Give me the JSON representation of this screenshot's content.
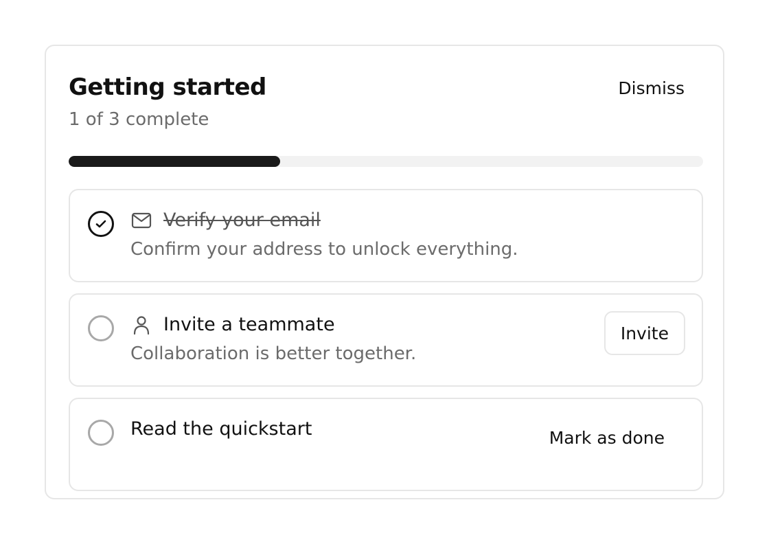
{
  "header": {
    "title": "Getting started",
    "progress_text": "1 of 3 complete",
    "dismiss_label": "Dismiss"
  },
  "progress": {
    "completed": 1,
    "total": 3,
    "fraction": 0.333,
    "fill_color": "#1a1a1a",
    "track_color": "#f2f2f2"
  },
  "tasks": [
    {
      "title": "Verify your email",
      "description": "Confirm your address to unlock everything.",
      "icon": "mail-icon",
      "done": true
    },
    {
      "title": "Invite a teammate",
      "description": "Collaboration is better together.",
      "icon": "user-icon",
      "done": false,
      "action_label": "Invite"
    },
    {
      "title": "Read the quickstart",
      "done": false,
      "action_label": "Mark as done"
    }
  ]
}
